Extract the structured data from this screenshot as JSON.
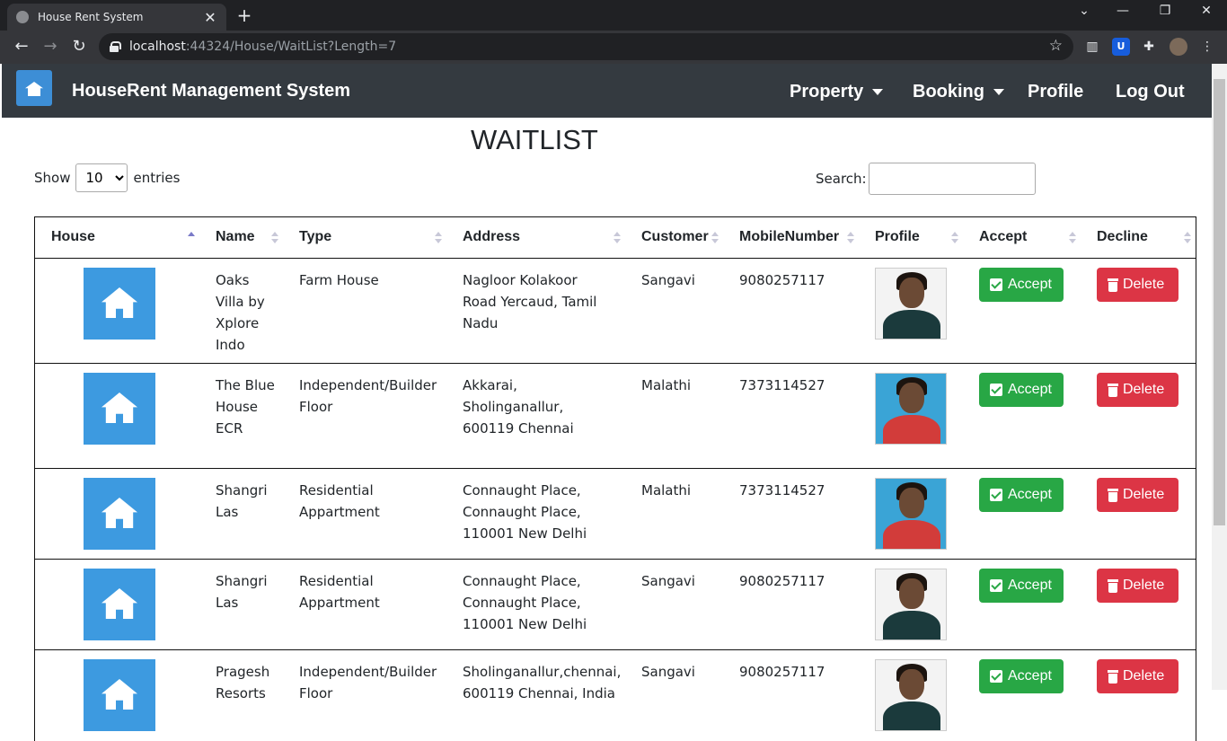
{
  "browser": {
    "tab_title": "House Rent System",
    "new_tab": "+",
    "url_host": "localhost",
    "url_path": ":44324/House/WaitList?Length=7"
  },
  "navbar": {
    "brand": "HouseRent Management System",
    "links": [
      {
        "label": "Property",
        "dropdown": true
      },
      {
        "label": "Booking",
        "dropdown": true
      },
      {
        "label": "Profile",
        "dropdown": false
      },
      {
        "label": "Log Out",
        "dropdown": false
      }
    ]
  },
  "page": {
    "heading": "WAITLIST",
    "show_label": "Show",
    "entries_label": "entries",
    "length_value": "10",
    "search_label": "Search:",
    "search_value": ""
  },
  "table": {
    "columns": [
      "House",
      "Name",
      "Type",
      "Address",
      "Customer",
      "MobileNumber",
      "Profile",
      "Accept",
      "Decline"
    ],
    "sorted_column": "House",
    "accept_label": "Accept",
    "delete_label": "Delete",
    "rows": [
      {
        "name": "Oaks Villa by Xplore Indo",
        "type": "Farm House",
        "address": "Nagloor Kolakoor Road Yercaud, Tamil Nadu",
        "customer": "Sangavi",
        "mobile": "9080257117",
        "profile_photo": "woman-dark-top"
      },
      {
        "name": "The Blue House ECR",
        "type": "Independent/Builder Floor",
        "address": "Akkarai, Sholinganallur, 600119 Chennai",
        "customer": "Malathi",
        "mobile": "7373114527",
        "profile_photo": "woman-red-saree-blue-background"
      },
      {
        "name": "Shangri Las",
        "type": "Residential Appartment",
        "address": "Connaught Place, Connaught Place, 110001 New Delhi",
        "customer": "Malathi",
        "mobile": "7373114527",
        "profile_photo": "woman-red-saree-blue-background"
      },
      {
        "name": "Shangri Las",
        "type": "Residential Appartment",
        "address": "Connaught Place, Connaught Place, 110001 New Delhi",
        "customer": "Sangavi",
        "mobile": "9080257117",
        "profile_photo": "woman-dark-top"
      },
      {
        "name": "Pragesh Resorts",
        "type": "Independent/Builder Floor",
        "address": "Sholinganallur,chennai, 600119 Chennai, India",
        "customer": "Sangavi",
        "mobile": "9080257117",
        "profile_photo": "woman-dark-top"
      }
    ]
  }
}
